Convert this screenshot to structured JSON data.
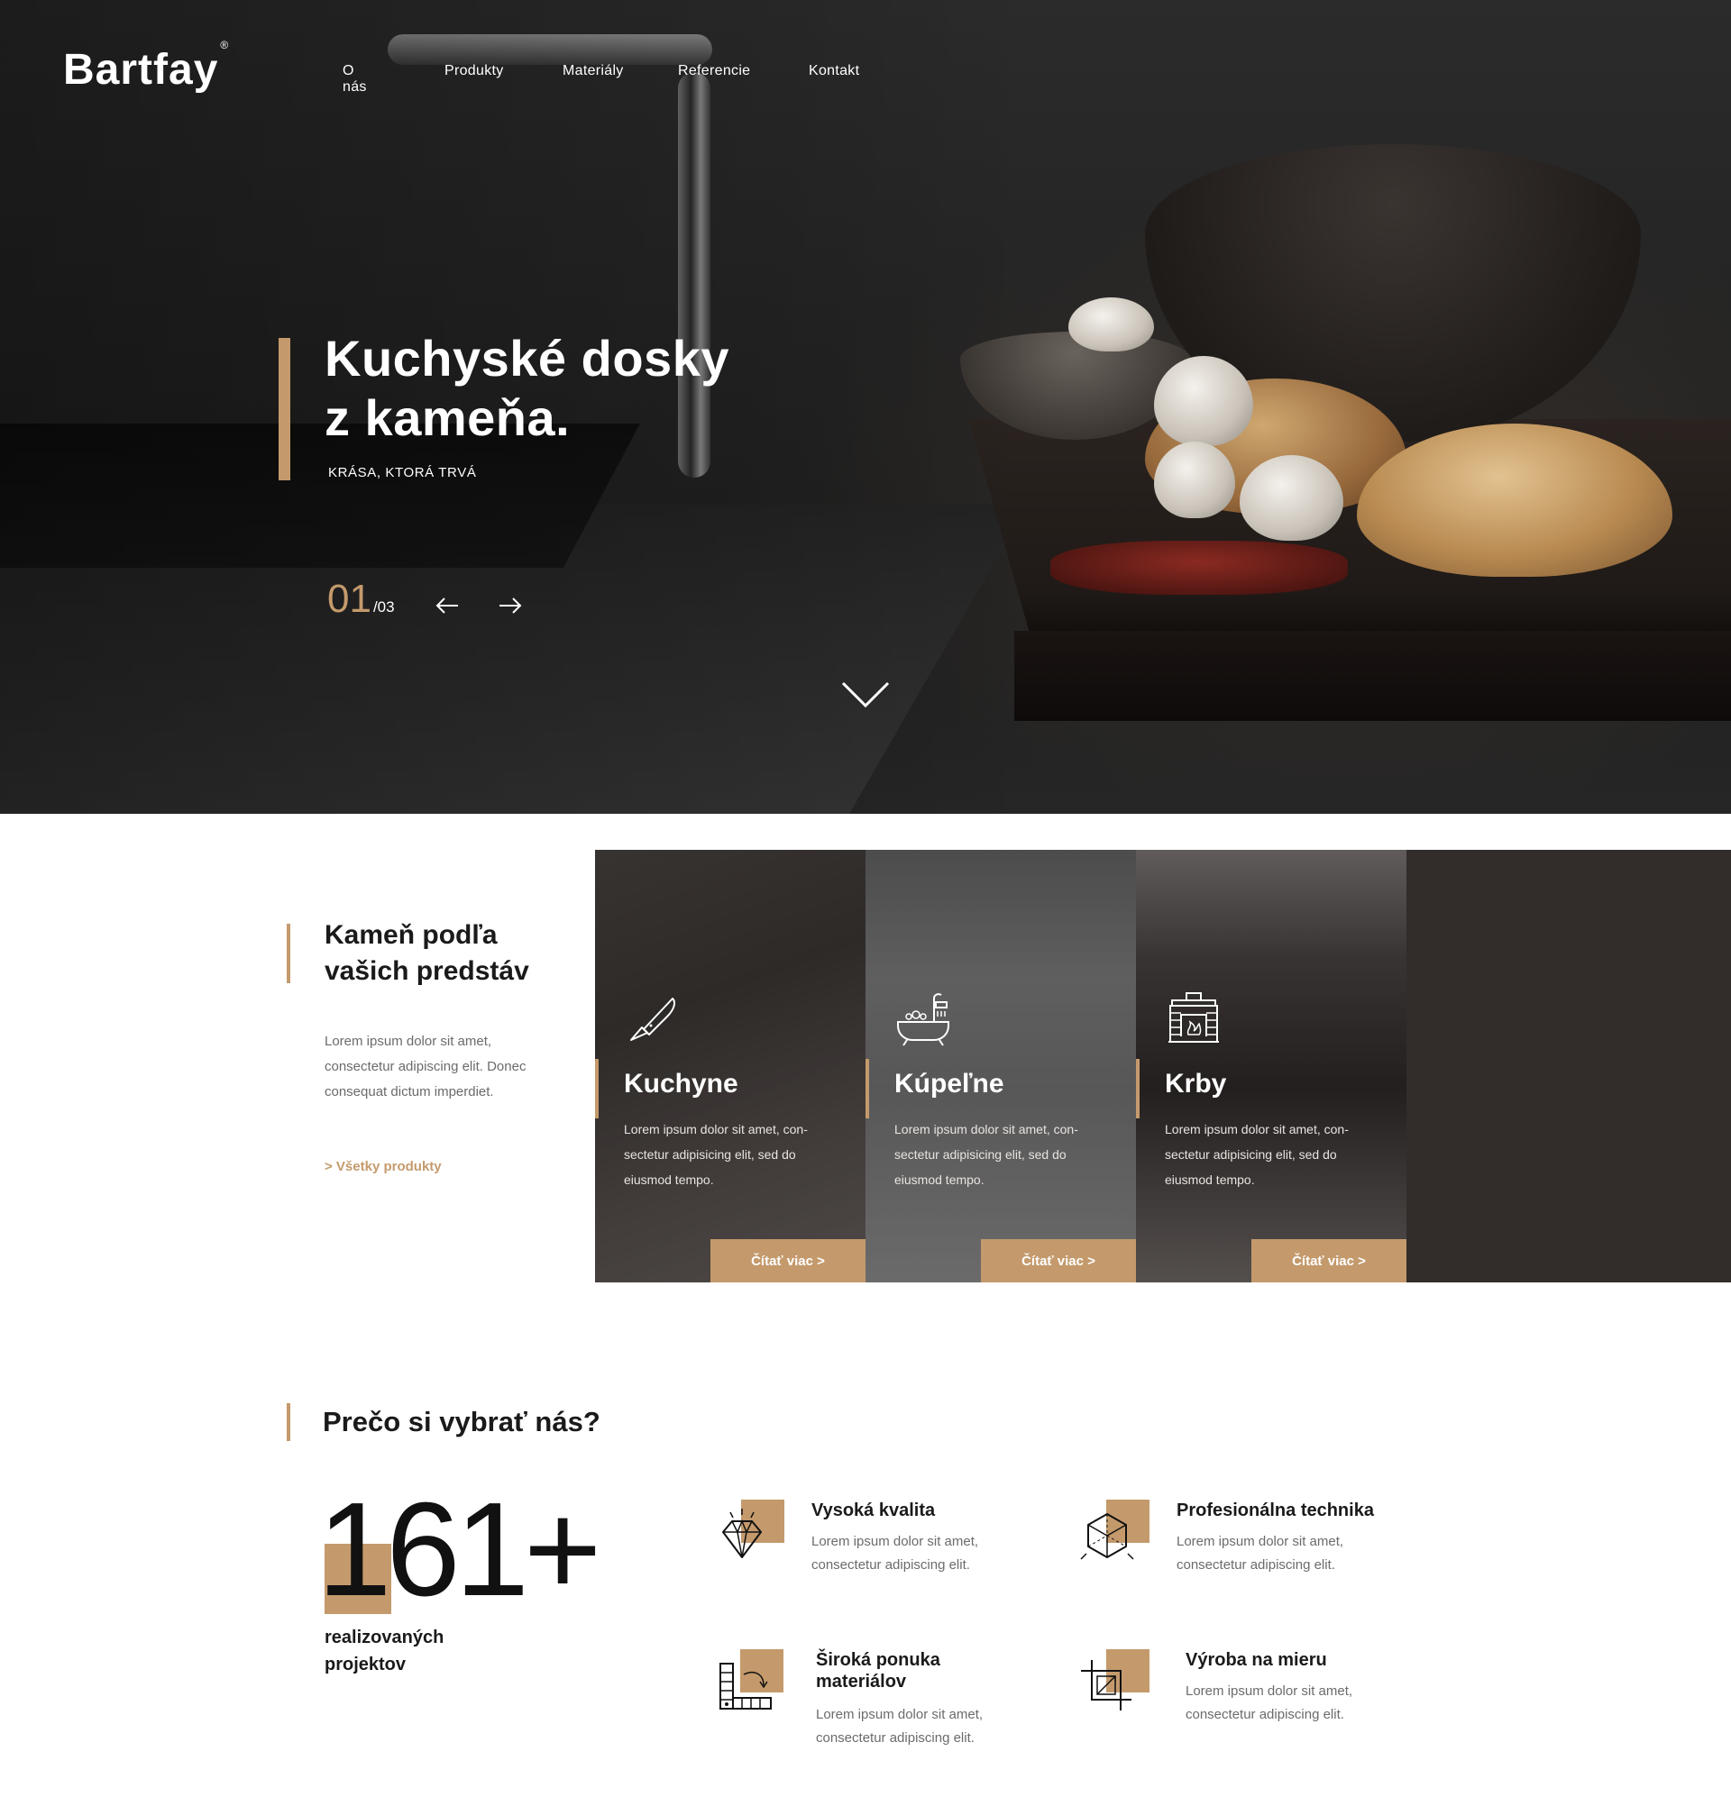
{
  "brand": {
    "logo": "Bartfay",
    "registered": "®"
  },
  "nav": {
    "items": [
      "O nás",
      "Produkty",
      "Materiály",
      "Referencie",
      "Kontakt"
    ]
  },
  "hero": {
    "title_line1": "Kuchyské dosky",
    "title_line2": "z kameňa.",
    "subtitle": "KRÁSA, KTORÁ TRVÁ",
    "slide_current": "01",
    "slide_total": "/03",
    "icons": {
      "prev": "arrow-left-icon",
      "next": "arrow-right-icon",
      "scroll": "chevron-down-icon"
    }
  },
  "products": {
    "title_line1": "Kameň podľa",
    "title_line2": "vašich predstáv",
    "text": "Lorem ipsum dolor sit amet, consectetur adipiscing elit. Donec consequat dictum imperdiet.",
    "link": "> Všetky produkty",
    "cards": [
      {
        "title": "Kuchyne",
        "text": "Lorem ipsum dolor sit amet, con-sectetur adipisicing elit, sed do eiusmod tempo.",
        "button": "Čítať viac >",
        "icon": "knife-icon"
      },
      {
        "title": "Kúpeľne",
        "text": "Lorem ipsum dolor sit amet, con-sectetur adipisicing elit, sed do eiusmod tempo.",
        "button": "Čítať viac >",
        "icon": "bathtub-icon"
      },
      {
        "title": "Krby",
        "text": "Lorem ipsum dolor sit amet, con-sectetur adipisicing elit, sed do eiusmod tempo.",
        "button": "Čítať viac >",
        "icon": "fireplace-icon"
      }
    ]
  },
  "why": {
    "title": "Prečo si vybrať nás?",
    "stat_number": "161+",
    "stat_label_line1": "realizovaných",
    "stat_label_line2": "projektov",
    "features": [
      {
        "title": "Vysoká kvalita",
        "text": "Lorem ipsum dolor sit amet, consectetur adipiscing elit.",
        "icon": "diamond-icon"
      },
      {
        "title": "Profesionálna technika",
        "text": "Lorem ipsum dolor sit amet, consectetur adipiscing elit.",
        "icon": "cube-icon"
      },
      {
        "title_line1": "Široká ponuka",
        "title_line2": "materiálov",
        "text": "Lorem ipsum dolor sit amet, consectetur adipiscing elit.",
        "icon": "material-swatches-icon"
      },
      {
        "title": "Výroba na mieru",
        "text": "Lorem ipsum dolor sit amet, consectetur adipiscing elit.",
        "icon": "crop-measure-icon"
      }
    ]
  },
  "colors": {
    "accent": "#c49a6c",
    "dark": "#322d2b",
    "text": "#1a1a1a",
    "muted": "#6b6b6b"
  }
}
